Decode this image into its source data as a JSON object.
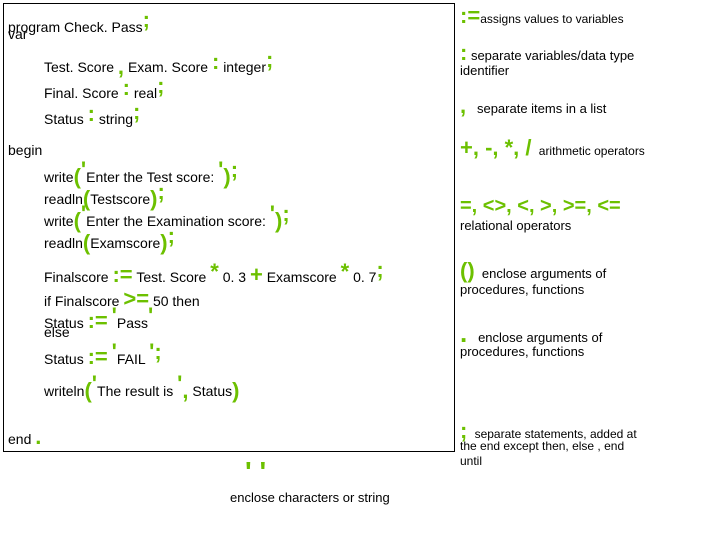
{
  "code": {
    "l1_a": "program Check. Pass",
    "l1_b": ";",
    "l2": "var",
    "l3_a": "Test. Score",
    "l3_b": ",",
    "l3_c": "Exam. Score",
    "l3_d": ":",
    "l3_e": "integer",
    "l3_f": ";",
    "l4_a": "Final. Score",
    "l4_b": ":",
    "l4_c": "real",
    "l4_d": ";",
    "l5_a": "Status",
    "l5_b": ":",
    "l5_c": "string",
    "l5_d": ";",
    "l6": "begin",
    "l7_a": "write",
    "l7_b": "(",
    "l7_c": "'",
    "l7_d": "Enter the Test score:",
    "l7_e": "'",
    "l7_f": ")",
    "l7_g": ";",
    "l8_a": "readln",
    "l8_b": "(",
    "l8_c": "Testscore",
    "l8_d": ")",
    "l8_e": ";",
    "l9_a": "write",
    "l9_b": "(",
    "l9_c": "'",
    "l9_d": "Enter the Examination score:",
    "l9_e": "'",
    "l9_f": ")",
    "l9_g": ";",
    "l10_a": "readln",
    "l10_b": "(",
    "l10_c": "Examscore",
    "l10_d": ")",
    "l10_e": ";",
    "l11_a": "Finalscore",
    "l11_b": ":=",
    "l11_c": "Test. Score",
    "l11_d": "*",
    "l11_e": "0. 3",
    "l11_f": "+",
    "l11_g": "Examscore",
    "l11_h": "*",
    "l11_i": "0. 7",
    "l11_j": ";",
    "l12_a": "if Finalscore",
    "l12_b": ">=",
    "l12_c": "50 then",
    "l13_a": "Status",
    "l13_b": ":=",
    "l13_c": "'",
    "l13_d": "Pass",
    "l13_e": "'",
    "l14": "else",
    "l15_a": "Status",
    "l15_b": ":=",
    "l15_c": "'",
    "l15_d": "FAIL",
    "l15_e": "'",
    "l15_f": ";",
    "l16_a": "writeln",
    "l16_b": "(",
    "l16_c": "'",
    "l16_d": "The result is",
    "l16_e": "'",
    "l16_f": ",",
    "l16_g": "Status",
    "l16_h": ")",
    "l17_a": "end",
    "l17_b": "."
  },
  "legend": {
    "assign_sym": ":=",
    "assign_txt": "assigns values to variables",
    "colon_sym": ":",
    "colon_txt1": "separate variables/data type",
    "colon_txt2": "identifier",
    "comma_sym": ",",
    "comma_txt": "separate items in a list",
    "arith_sym": "+, -, *, /",
    "arith_txt": "arithmetic operators",
    "rel_sym": "=, <>, <, >, >=, <=",
    "rel_txt": "relational operators",
    "paren_sym": "()",
    "paren_txt1": "enclose arguments of",
    "paren_txt2": "procedures, functions",
    "dot_sym": ".",
    "dot_txt1": "enclose arguments of",
    "dot_txt2": "procedures, functions",
    "semi_sym": ";",
    "semi_txt1": "separate statements, added at",
    "semi_txt2": "the end except then, else , end",
    "semi_txt3": "until",
    "quote_sym": "' '",
    "quote_txt": "enclose characters or string"
  }
}
